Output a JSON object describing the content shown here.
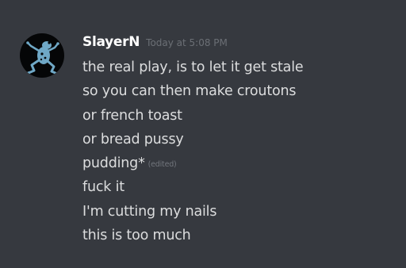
{
  "message": {
    "author": "SlayerN",
    "timestamp": "Today at 5:08 PM",
    "avatar_icon": "frog-avatar-icon",
    "edited_label": "(edited)",
    "lines": [
      "the real play, is to let it get stale",
      "so you can then make croutons",
      "or french toast",
      "or bread pussy",
      "pudding*",
      "fuck it",
      "I'm cutting my nails",
      "this is too much"
    ],
    "edited_line_index": 4
  },
  "colors": {
    "background": "#36393f",
    "username": "#ffffff",
    "message_text": "#dcddde",
    "timestamp": "#6b6f75",
    "avatar_bg": "#050607",
    "avatar_figure": "#6fa8c6"
  }
}
